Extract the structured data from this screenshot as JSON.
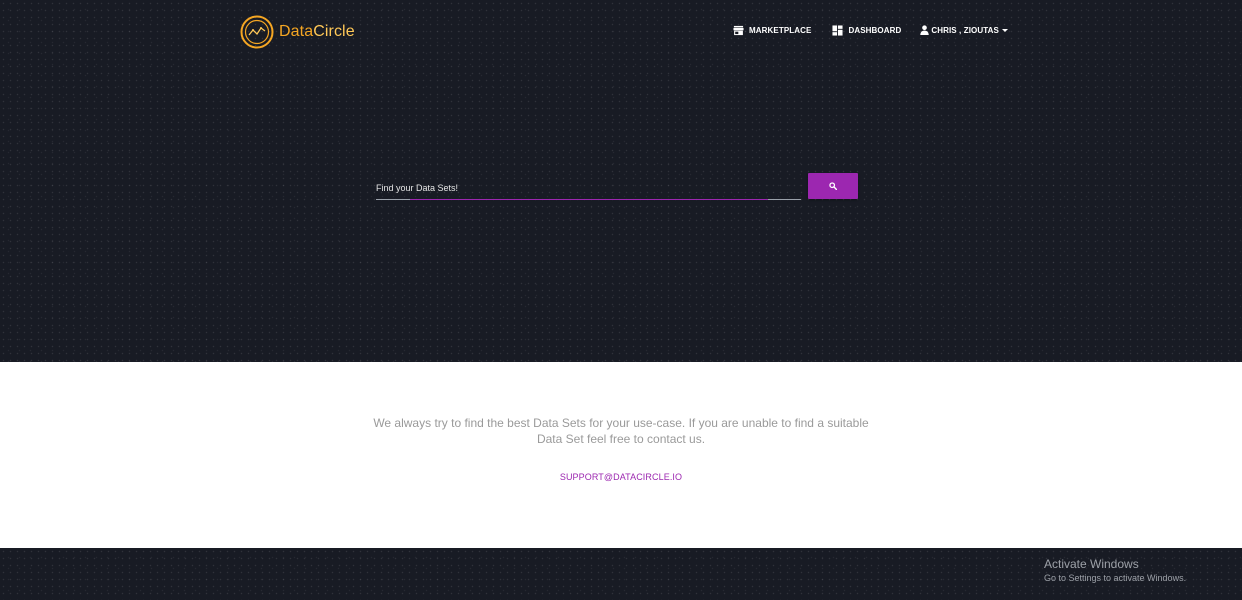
{
  "brand": {
    "name_part1": "Data",
    "name_part2": "Circle",
    "logo_icon": "chart-circle-logo-icon",
    "colors": {
      "primary": "#f5a623",
      "secondary": "#ffc857"
    }
  },
  "nav": {
    "items": [
      {
        "label": "MARKETPLACE",
        "icon": "storefront-icon"
      },
      {
        "label": "DASHBOARD",
        "icon": "dashboard-icon"
      },
      {
        "label": "CHRIS , ZIOUTAS",
        "icon": "user-icon",
        "dropdown": true
      }
    ]
  },
  "search": {
    "placeholder": "Find your Data Sets!",
    "button_icon": "search-icon",
    "accent_color": "#9c27b0"
  },
  "info": {
    "text": "We always try to find the best Data Sets for your use-case. If you are unable to find a suitable Data Set feel free to contact us.",
    "support_link": "SUPPORT@DATACIRCLE.IO"
  },
  "watermark": {
    "title": "Activate Windows",
    "subtitle": "Go to Settings to activate Windows."
  }
}
